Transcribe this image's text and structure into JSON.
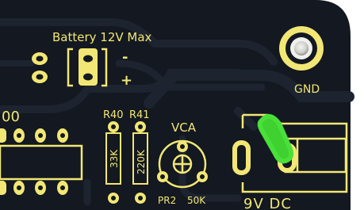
{
  "board": {
    "colors": {
      "background": "#ffffff",
      "soldermask": "#131821",
      "trace": "#1f2733",
      "silkscreen": "#f2e774",
      "pad": "#d9d9d4",
      "pad_shadow": "#9a9a94",
      "highlight": "#3ed12f"
    },
    "labels": {
      "battery": "Battery 12V Max",
      "minus_sign": "-",
      "plus_sign": "+",
      "gnd": "GND",
      "partial_ref": "00",
      "r40": "R40",
      "r41": "R41",
      "r40_value": "33K",
      "r41_value": "220K",
      "vca": "VCA",
      "pr2": "PR2",
      "pot_value": "50K",
      "dc_jack": "9V DC"
    }
  }
}
